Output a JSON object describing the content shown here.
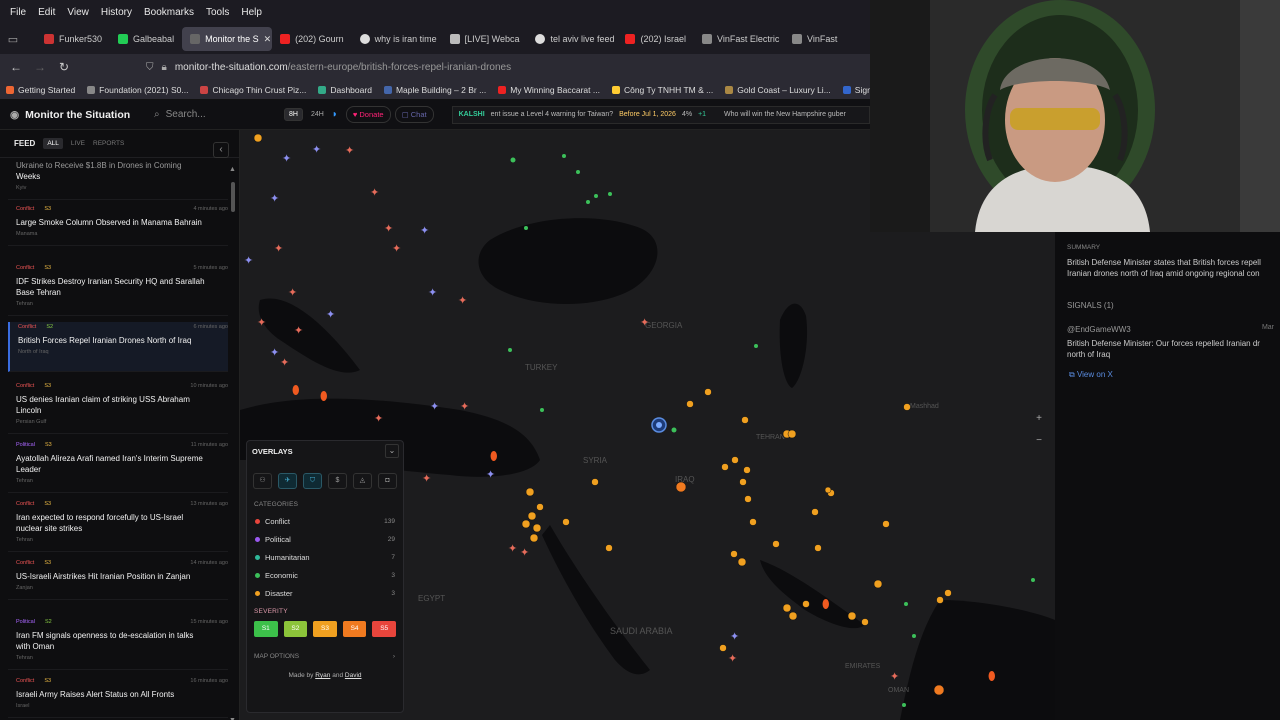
{
  "browser": {
    "menu": [
      "File",
      "Edit",
      "View",
      "History",
      "Bookmarks",
      "Tools",
      "Help"
    ],
    "tabs": [
      {
        "label": "Funker530",
        "color": "#c33"
      },
      {
        "label": "Galbeabal",
        "color": "#2c5"
      },
      {
        "label": "Monitor the S",
        "color": "#444",
        "active": true
      },
      {
        "label": "(202) Gourn",
        "color": "#e22"
      },
      {
        "label": "why is iran time",
        "color": "#ddd"
      },
      {
        "label": "[LIVE] Webca",
        "color": "#bbb"
      },
      {
        "label": "tel aviv live feed",
        "color": "#ddd"
      },
      {
        "label": "(202) Israel",
        "color": "#e22"
      },
      {
        "label": "VinFast Electric",
        "color": "#888"
      },
      {
        "label": "VinFast",
        "color": "#888"
      }
    ],
    "url_host": "monitor-the-situation.com",
    "url_path": "/eastern-europe/british-forces-repel-iranian-drones",
    "bookmarks": [
      {
        "label": "Getting Started",
        "color": "#e63"
      },
      {
        "label": "Foundation (2021) S0...",
        "color": "#888"
      },
      {
        "label": "Chicago Thin Crust Piz...",
        "color": "#c44"
      },
      {
        "label": "Dashboard",
        "color": "#3a8"
      },
      {
        "label": "Maple Building – 2 Br ...",
        "color": "#46a"
      },
      {
        "label": "My Winning Baccarat ...",
        "color": "#e22"
      },
      {
        "label": "Công Ty TNHH TM & ...",
        "color": "#fc3"
      },
      {
        "label": "Gold Coast – Luxury Li...",
        "color": "#a84"
      },
      {
        "label": "Sign in - Drea",
        "color": "#36c"
      }
    ]
  },
  "app": {
    "title": "Monitor the Situation",
    "search_placeholder": "Search...",
    "range_8h": "8H",
    "range_24h": "24H",
    "donate": "Donate",
    "chat": "Chat",
    "ticker_brand": "KALSHI",
    "ticker_text": "ent issue a Level 4 warning for Taiwan?",
    "ticker_date": "Before Jul 1, 2026",
    "ticker_pct": "4%",
    "ticker_delta": "+1",
    "ticker_text2": "Who will win the New Hampshire guber"
  },
  "feed": {
    "title": "FEED",
    "filters": [
      "ALL",
      "LIVE",
      "REPORTS"
    ],
    "partial_title": "Ukraine to Receive $1.8B in Drones in Coming",
    "partial_title2": "Weeks",
    "partial_loc": "Kyiv",
    "items": [
      {
        "cat": "Conflict",
        "sev": "S3",
        "ago": "4 minutes ago",
        "title": "Large Smoke Column Observed in Manama Bahrain",
        "title2": "",
        "loc": "Manama",
        "kind": "c"
      },
      {
        "cat": "Conflict",
        "sev": "S3",
        "ago": "5 minutes ago",
        "title": "IDF Strikes Destroy Iranian Security HQ and Sarallah",
        "title2": "Base Tehran",
        "loc": "Tehran",
        "kind": "c"
      },
      {
        "cat": "Conflict",
        "sev": "S2",
        "ago": "6 minutes ago",
        "title": "British Forces Repel Iranian Drones North of Iraq",
        "title2": "",
        "loc": "North of Iraq",
        "kind": "c",
        "selected": true
      },
      {
        "cat": "Conflict",
        "sev": "S3",
        "ago": "10 minutes ago",
        "title": "US denies Iranian claim of striking USS Abraham",
        "title2": "Lincoln",
        "loc": "Persian Gulf",
        "kind": "c"
      },
      {
        "cat": "Political",
        "sev": "S3",
        "ago": "11 minutes ago",
        "title": "Ayatollah Alireza Arafi named Iran's Interim Supreme",
        "title2": "Leader",
        "loc": "Tehran",
        "kind": "p"
      },
      {
        "cat": "Conflict",
        "sev": "S3",
        "ago": "13 minutes ago",
        "title": "Iran expected to respond forcefully to US-Israel",
        "title2": "nuclear site strikes",
        "loc": "Tehran",
        "kind": "c"
      },
      {
        "cat": "Conflict",
        "sev": "S3",
        "ago": "14 minutes ago",
        "title": "US-Israeli Airstrikes Hit Iranian Position in Zanjan",
        "title2": "",
        "loc": "Zanjan",
        "kind": "c"
      },
      {
        "cat": "Political",
        "sev": "S2",
        "ago": "15 minutes ago",
        "title": "Iran FM signals openness to de-escalation in talks",
        "title2": "with Oman",
        "loc": "Tehran",
        "kind": "p"
      },
      {
        "cat": "Conflict",
        "sev": "S3",
        "ago": "16 minutes ago",
        "title": "Israeli Army Raises Alert Status on All Fronts",
        "title2": "",
        "loc": "Israel",
        "kind": "c"
      }
    ]
  },
  "map": {
    "labels": {
      "georgia": "GEORGIA",
      "turkey": "TURKEY",
      "syria": "SYRIA",
      "iraq": "IRAQ",
      "egypt": "EGYPT",
      "saudi": "SAUDI ARABIA",
      "tehran": "TEHRAN",
      "mashhad": "Mashhad",
      "oman": "OMAN",
      "emirates": "EMIRATES"
    },
    "zoom_in": "+",
    "zoom_out": "−"
  },
  "overlays": {
    "title": "OVERLAYS",
    "categories_label": "CATEGORIES",
    "categories": [
      {
        "name": "Conflict",
        "count": "139",
        "color": "#e8453c"
      },
      {
        "name": "Political",
        "count": "29",
        "color": "#9b59f0"
      },
      {
        "name": "Humanitarian",
        "count": "7",
        "color": "#2fb89a"
      },
      {
        "name": "Economic",
        "count": "3",
        "color": "#3cc05a"
      },
      {
        "name": "Disaster",
        "count": "3",
        "color": "#f0a020"
      }
    ],
    "severity_label": "SEVERITY",
    "severity": [
      {
        "label": "S1",
        "color": "#3cc04a"
      },
      {
        "label": "S2",
        "color": "#8cc43a"
      },
      {
        "label": "S3",
        "color": "#f0a020"
      },
      {
        "label": "S4",
        "color": "#f07a20"
      },
      {
        "label": "S5",
        "color": "#e8453c"
      }
    ],
    "map_options": "MAP OPTIONS",
    "credit_prefix": "Made by",
    "credit_a": "Ryan",
    "credit_and": "and",
    "credit_b": "David"
  },
  "detail": {
    "summary_label": "SUMMARY",
    "summary_1": "British Defense Minister states that British forces repell",
    "summary_2": "Iranian drones north of Iraq amid ongoing regional con",
    "signals_label": "SIGNALS (1)",
    "signal_user": "@EndGameWW3",
    "signal_date": "Mar",
    "signal_1": "British Defense Minister: Our forces repelled Iranian dr",
    "signal_2": "north of Iraq",
    "view_link": "View on X"
  }
}
